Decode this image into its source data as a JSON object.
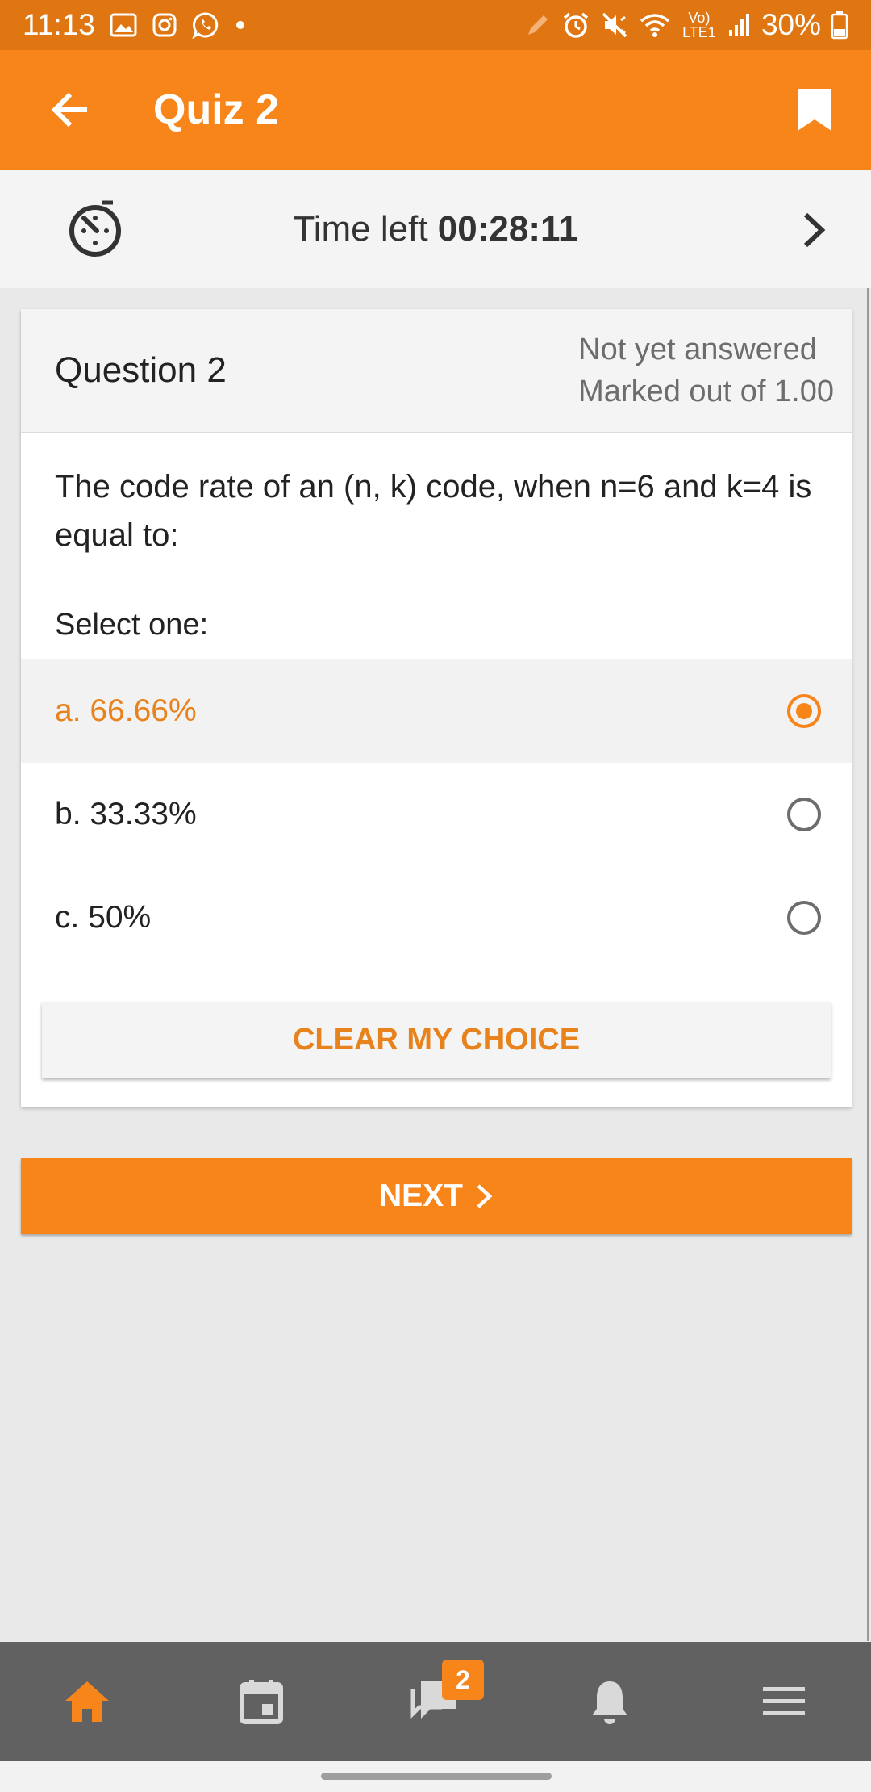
{
  "status_bar": {
    "time": "11:13",
    "battery": "30%",
    "network_label": "Vo) LTE1",
    "left_icons": [
      "gallery-icon",
      "instagram-icon",
      "whatsapp-icon",
      "dot-icon"
    ],
    "right_icons": [
      "pen-icon",
      "alarm-icon",
      "mute-icon",
      "wifi-icon",
      "signal-icon",
      "battery-icon"
    ]
  },
  "app_bar": {
    "title": "Quiz 2",
    "back_icon": "arrow-left-icon",
    "bookmark_icon": "bookmark-icon"
  },
  "timer": {
    "prefix": "Time left ",
    "value": "00:28:11",
    "icon": "timer-icon",
    "next_icon": "chevron-right-icon"
  },
  "question": {
    "number": "Question 2",
    "status": "Not yet answered",
    "marks": "Marked out of 1.00",
    "text": "The code rate of an (n, k) code, when n=6 and k=4 is equal to:",
    "instruction": "Select one:",
    "options": [
      {
        "label": "a. 66.66%",
        "selected": true
      },
      {
        "label": "b. 33.33%",
        "selected": false
      },
      {
        "label": "c. 50%",
        "selected": false
      }
    ],
    "clear_label": "CLEAR MY CHOICE"
  },
  "next_button": {
    "label": "NEXT"
  },
  "bottom_nav": {
    "items": [
      "home-icon",
      "calendar-icon",
      "messages-icon",
      "notifications-icon",
      "menu-icon"
    ],
    "messages_badge": "2",
    "active": "home-icon"
  },
  "colors": {
    "accent": "#f7851a",
    "status_bar": "#e07612",
    "bottom_nav": "#616161"
  }
}
